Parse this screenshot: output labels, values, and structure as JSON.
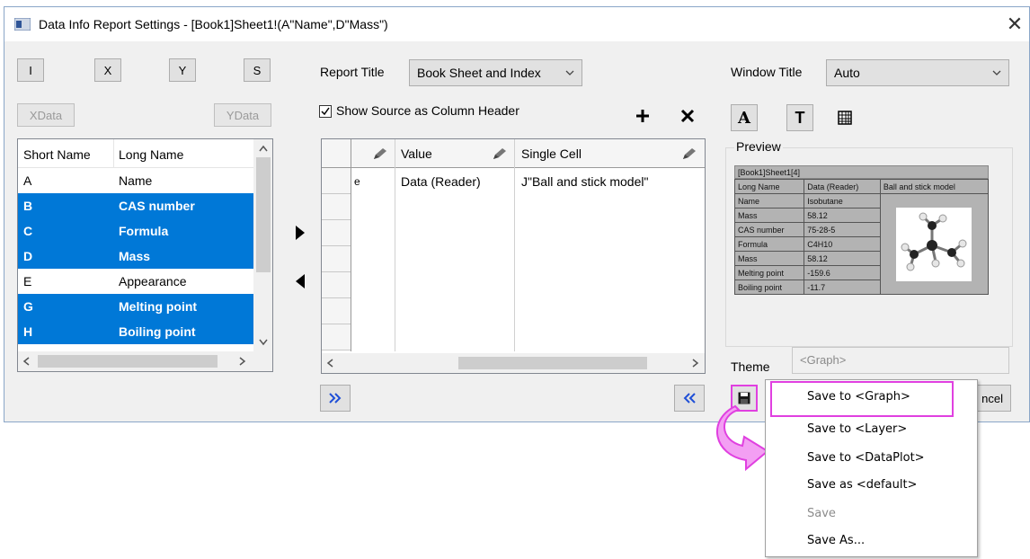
{
  "window": {
    "title": "Data Info Report Settings - [Book1]Sheet1!(A\"Name\",D\"Mass\")",
    "close_glyph": "✕"
  },
  "designation_buttons": [
    "I",
    "X",
    "Y",
    "S"
  ],
  "data_buttons": [
    "XData",
    "YData"
  ],
  "column_list": {
    "headers": [
      "Short Name",
      "Long Name"
    ],
    "rows": [
      {
        "short": "A",
        "long": "Name",
        "selected": false
      },
      {
        "short": "B",
        "long": "CAS number",
        "selected": true
      },
      {
        "short": "C",
        "long": "Formula",
        "selected": true
      },
      {
        "short": "D",
        "long": "Mass",
        "selected": true
      },
      {
        "short": "E",
        "long": "Appearance",
        "selected": false
      },
      {
        "short": "G",
        "long": "Melting point",
        "selected": true
      },
      {
        "short": "H",
        "long": "Boiling point",
        "selected": true
      }
    ]
  },
  "report_title": {
    "label": "Report Title",
    "value": "Book Sheet and Index"
  },
  "show_source": {
    "label": "Show Source as Column Header",
    "checked": true
  },
  "report_grid": {
    "headers": [
      "Value",
      "Single Cell"
    ],
    "row1": {
      "partial": "e",
      "value": "Data (Reader)",
      "single_cell": "J\"Ball and stick model\""
    }
  },
  "window_title": {
    "label": "Window Title",
    "value": "Auto"
  },
  "preview": {
    "label": "Preview",
    "sheet_title": "[Book1]Sheet1[4]",
    "headers": [
      "Long Name",
      "Data (Reader)",
      "Ball and stick model"
    ],
    "rows": [
      [
        "Name",
        "Isobutane"
      ],
      [
        "Mass",
        "58.12"
      ],
      [
        "CAS number",
        "75-28-5"
      ],
      [
        "Formula",
        "C4H10"
      ],
      [
        "Mass",
        "58.12"
      ],
      [
        "Melting point",
        "-159.6"
      ],
      [
        "Boiling point",
        "-11.7"
      ]
    ]
  },
  "theme": {
    "label": "Theme",
    "placeholder": "<Graph>"
  },
  "cancel_partial": "ncel",
  "menu": {
    "items": [
      {
        "label": "Save to <Graph>",
        "enabled": true,
        "highlighted": true
      },
      {
        "label": "Save to <Layer>",
        "enabled": true
      },
      {
        "label": "Save to <DataPlot>",
        "enabled": true
      },
      {
        "label": "Save as <default>",
        "enabled": true
      },
      {
        "label": "Save",
        "enabled": false
      },
      {
        "label": "Save As...",
        "enabled": true
      }
    ]
  },
  "colors": {
    "selection": "#0078d7",
    "annotation": "#e040e0",
    "arrow_fill": "#f39ff3"
  }
}
